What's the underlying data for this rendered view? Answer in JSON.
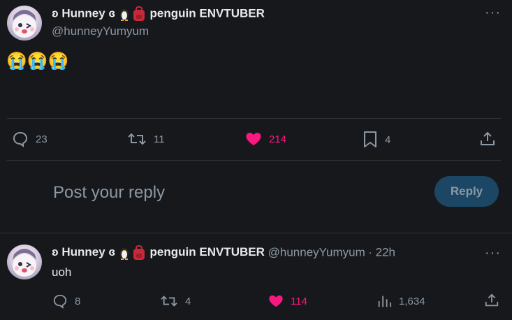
{
  "main_tweet": {
    "display_name_prefix": "ʚ Hunney ɞ",
    "display_name_suffix": "penguin ENVTUBER",
    "handle": "@hunneyYumyum",
    "body": "😭😭😭",
    "more_icon": "more-dots-icon",
    "actions": {
      "replies": "23",
      "retweets": "11",
      "likes": "214",
      "bookmarks": "4"
    }
  },
  "reply_box": {
    "placeholder": "Post your reply",
    "button_label": "Reply"
  },
  "reply_tweet": {
    "display_name_prefix": "ʚ Hunney ɞ",
    "display_name_suffix": "penguin ENVTUBER",
    "handle": "@hunneyYumyum",
    "time": "· 22h",
    "body": "uoh",
    "actions": {
      "replies": "8",
      "retweets": "4",
      "likes": "114",
      "views": "1,634"
    }
  },
  "colors": {
    "background": "#17181c",
    "like_pink": "#f91880",
    "muted": "#8b98a5",
    "reply_button": "#1b4664"
  }
}
